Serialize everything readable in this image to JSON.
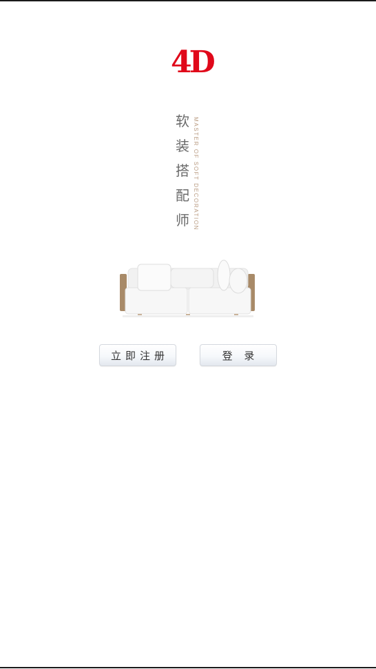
{
  "brand": {
    "logo_text": "4D",
    "logo_color": "#e0081a"
  },
  "title": {
    "chars": [
      "软",
      "装",
      "搭",
      "配",
      "师"
    ],
    "subtitle": "MASTER OF SOFT DECORATION"
  },
  "actions": {
    "register_label": "立即注册",
    "login_label": "登 录"
  }
}
